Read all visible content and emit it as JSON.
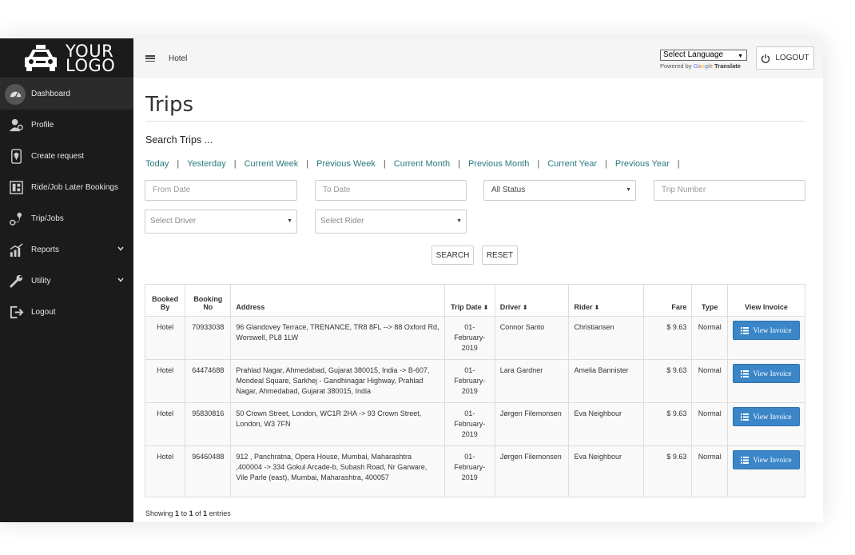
{
  "logo": {
    "line1": "YOUR",
    "line2": "LOGO"
  },
  "sidebar": {
    "items": [
      {
        "label": "Dashboard",
        "icon": "dashboard-icon"
      },
      {
        "label": "Profile",
        "icon": "profile-icon"
      },
      {
        "label": "Create request",
        "icon": "location-icon"
      },
      {
        "label": "Ride/Job Later Bookings",
        "icon": "bookings-icon"
      },
      {
        "label": "Trip/Jobs",
        "icon": "trip-icon"
      },
      {
        "label": "Reports",
        "icon": "reports-icon"
      },
      {
        "label": "Utility",
        "icon": "wrench-icon"
      },
      {
        "label": "Logout",
        "icon": "logout-icon"
      }
    ]
  },
  "topbar": {
    "section": "Hotel",
    "language_select": "Select Language",
    "powered_by": "Powered by",
    "google": "Google",
    "translate": "Translate",
    "logout": "LOGOUT"
  },
  "main": {
    "title": "Trips",
    "search_heading": "Search Trips ...",
    "filters": [
      "Today",
      "Yesterday",
      "Current Week",
      "Previous Week",
      "Current Month",
      "Previous Month",
      "Current Year",
      "Previous Year"
    ],
    "from_date_placeholder": "From Date",
    "to_date_placeholder": "To Date",
    "status_select": "All Status",
    "trip_number_placeholder": "Trip Number",
    "driver_select": "Select Driver",
    "rider_select": "Select Rider",
    "search_button": "SEARCH",
    "reset_button": "RESET"
  },
  "table": {
    "headers": {
      "booked_by": "Booked By",
      "booking_no": "Booking No",
      "address": "Address",
      "trip_date": "Trip Date",
      "driver": "Driver",
      "rider": "Rider",
      "fare": "Fare",
      "type": "Type",
      "view_invoice": "View Invoice"
    },
    "invoice_button": "View Invoice",
    "rows": [
      {
        "booked_by": "Hotel",
        "booking_no": "70933038",
        "address": "96 Glandovey Terrace, TRENANCE, TR8 8FL --> 88 Oxford Rd, Worswell, PL8 1LW",
        "trip_date": "01-February-2019",
        "driver": "Connor Santo",
        "rider": "Christiansen",
        "fare": "$ 9.63",
        "type": "Normal"
      },
      {
        "booked_by": "Hotel",
        "booking_no": "64474688",
        "address": "Prahlad Nagar, Ahmedabad, Gujarat 380015, India -> B-607, Mondeal Square, Sarkhej - Gandhinagar Highway, Prahlad Nagar, Ahmedabad, Gujarat 380015, India",
        "trip_date": "01-February-2019",
        "driver": "Lara Gardner",
        "rider": "Amelia Bannister",
        "fare": "$ 9.63",
        "type": "Normal"
      },
      {
        "booked_by": "Hotel",
        "booking_no": "95830816",
        "address": "50 Crown Street, London, WC1R 2HA -> 93 Crown Street, London, W3 7FN",
        "trip_date": "01-February-2019",
        "driver": "Jørgen Filemonsen",
        "rider": "Eva Neighbour",
        "fare": "$ 9.63",
        "type": "Normal"
      },
      {
        "booked_by": "Hotel",
        "booking_no": "96460488",
        "address": "912 , Panchratna, Opera House, Mumbai, Maharashtra ,400004 -> 334 Gokul Arcade-b, Subash Road, Nr Garware, Vile Parle (east), Mumbai, Maharashtra, 400057",
        "trip_date": "01-February-2019",
        "driver": "Jørgen Filemonsen",
        "rider": "Eva Neighbour",
        "fare": "$ 9.63",
        "type": "Normal"
      }
    ]
  },
  "footer": {
    "showing": "Showing",
    "from": "1",
    "to_word": "to",
    "to": "1",
    "of_word": "of",
    "total": "1",
    "entries": "entries"
  }
}
